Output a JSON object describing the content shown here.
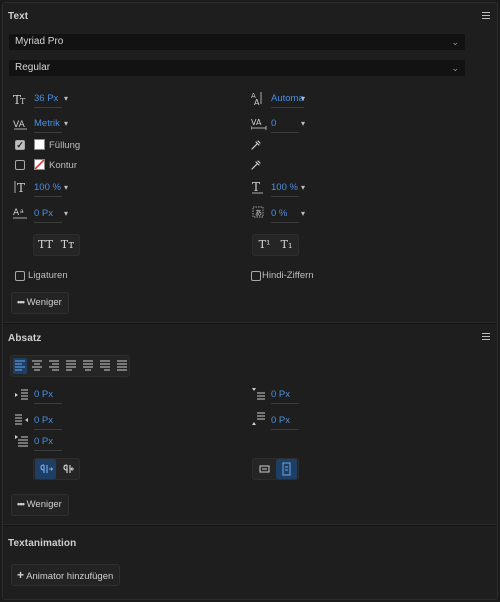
{
  "text_section": {
    "title": "Text",
    "font_family": "Myriad Pro",
    "font_style": "Regular",
    "font_size": "36 Px",
    "leading": "Automatic",
    "kerning": "Metrik",
    "tracking": "0",
    "fill_label": "Füllung",
    "stroke_label": "Kontur",
    "vertical_scale": "100 %",
    "horizontal_scale": "100 %",
    "baseline_shift": "0 Px",
    "tsume": "0 %",
    "all_caps": "TT",
    "small_caps": "Tт",
    "superscript": "T¹",
    "subscript": "T₁",
    "ligatures_label": "Ligaturen",
    "hindi_digits_label": "Hindi-Ziffern",
    "less_label": "Weniger",
    "fill_checked": true,
    "stroke_checked": false,
    "fill_color": "#ffffff",
    "stroke_none_color": "#e0302a"
  },
  "paragraph_section": {
    "title": "Absatz",
    "indent_left": "0 Px",
    "space_before": "0 Px",
    "indent_right": "0 Px",
    "space_after": "0 Px",
    "first_line_indent": "0 Px",
    "less_label": "Weniger"
  },
  "animation_section": {
    "title": "Textanimation",
    "add_animator": "Animator hinzufügen"
  },
  "colors": {
    "accent": "#4a90e2"
  }
}
